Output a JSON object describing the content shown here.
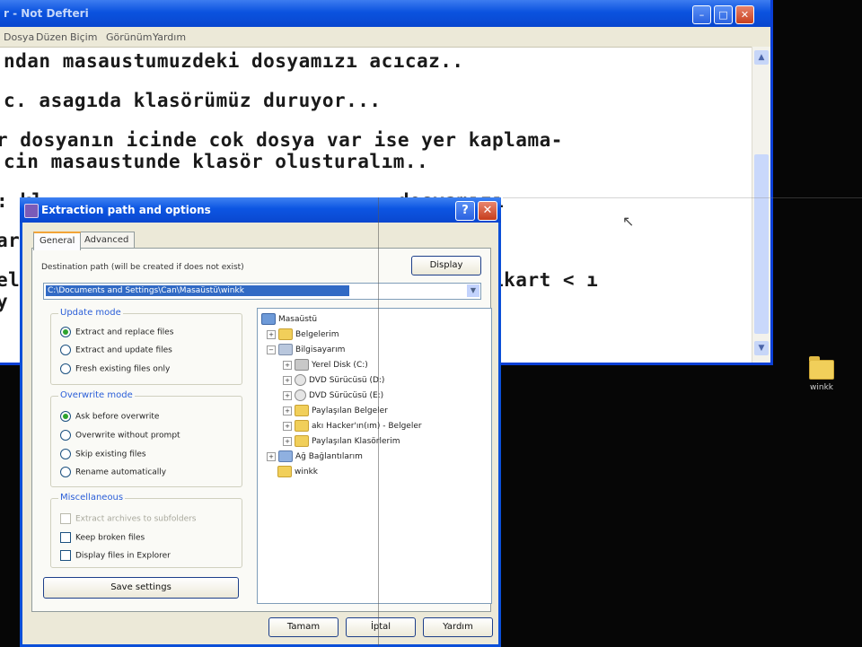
{
  "notepad": {
    "title": "r - Not Defteri",
    "menu": [
      "Dosya",
      "Düzen",
      "Biçim",
      "Görünüm",
      "Yardım"
    ],
    "lines": [
      "ndan masaustumuzdeki dosyamızı acıcaz..",
      "c. asagıda klasörümüz duruyor...",
      "r dosyanın icinde cok dosya var ise yer kaplama-",
      "cin masaustunde klasör olusturalım..",
      ": kl                              dosyamızı",
      "ar",
      "el                                       cıkart < ı",
      "y"
    ]
  },
  "desktop_icon": {
    "label": "winkk",
    "icon": "folder-icon"
  },
  "dialog": {
    "title": "Extraction path and options",
    "tabs": [
      "General",
      "Advanced"
    ],
    "destination_label": "Destination path (will be created if does not exist)",
    "display_button": "Display",
    "destination_path": "C:\\Documents and Settings\\Can\\Masaüstü\\winkk",
    "update_mode": {
      "title": "Update mode",
      "options": [
        "Extract and replace files",
        "Extract and update files",
        "Fresh existing files only"
      ],
      "selected": 0
    },
    "overwrite_mode": {
      "title": "Overwrite mode",
      "options": [
        "Ask before overwrite",
        "Overwrite without prompt",
        "Skip existing files",
        "Rename automatically"
      ],
      "selected": 0
    },
    "miscellaneous": {
      "title": "Miscellaneous",
      "options": [
        "Extract archives to subfolders",
        "Keep broken files",
        "Display files in Explorer"
      ]
    },
    "save_settings": "Save settings",
    "tree": [
      "Masaüstü",
      "Belgelerim",
      "Bilgisayarım",
      "Yerel Disk (C:)",
      "DVD Sürücüsü (D:)",
      "DVD Sürücüsü (E:)",
      "Paylaşılan Belgeler",
      "akı Hacker'ın(ım) - Belgeler",
      "Paylaşılan Klasörlerim",
      "Ağ Bağlantılarım",
      "winkk"
    ],
    "buttons": {
      "ok": "Tamam",
      "cancel": "İptal",
      "help": "Yardım"
    }
  }
}
